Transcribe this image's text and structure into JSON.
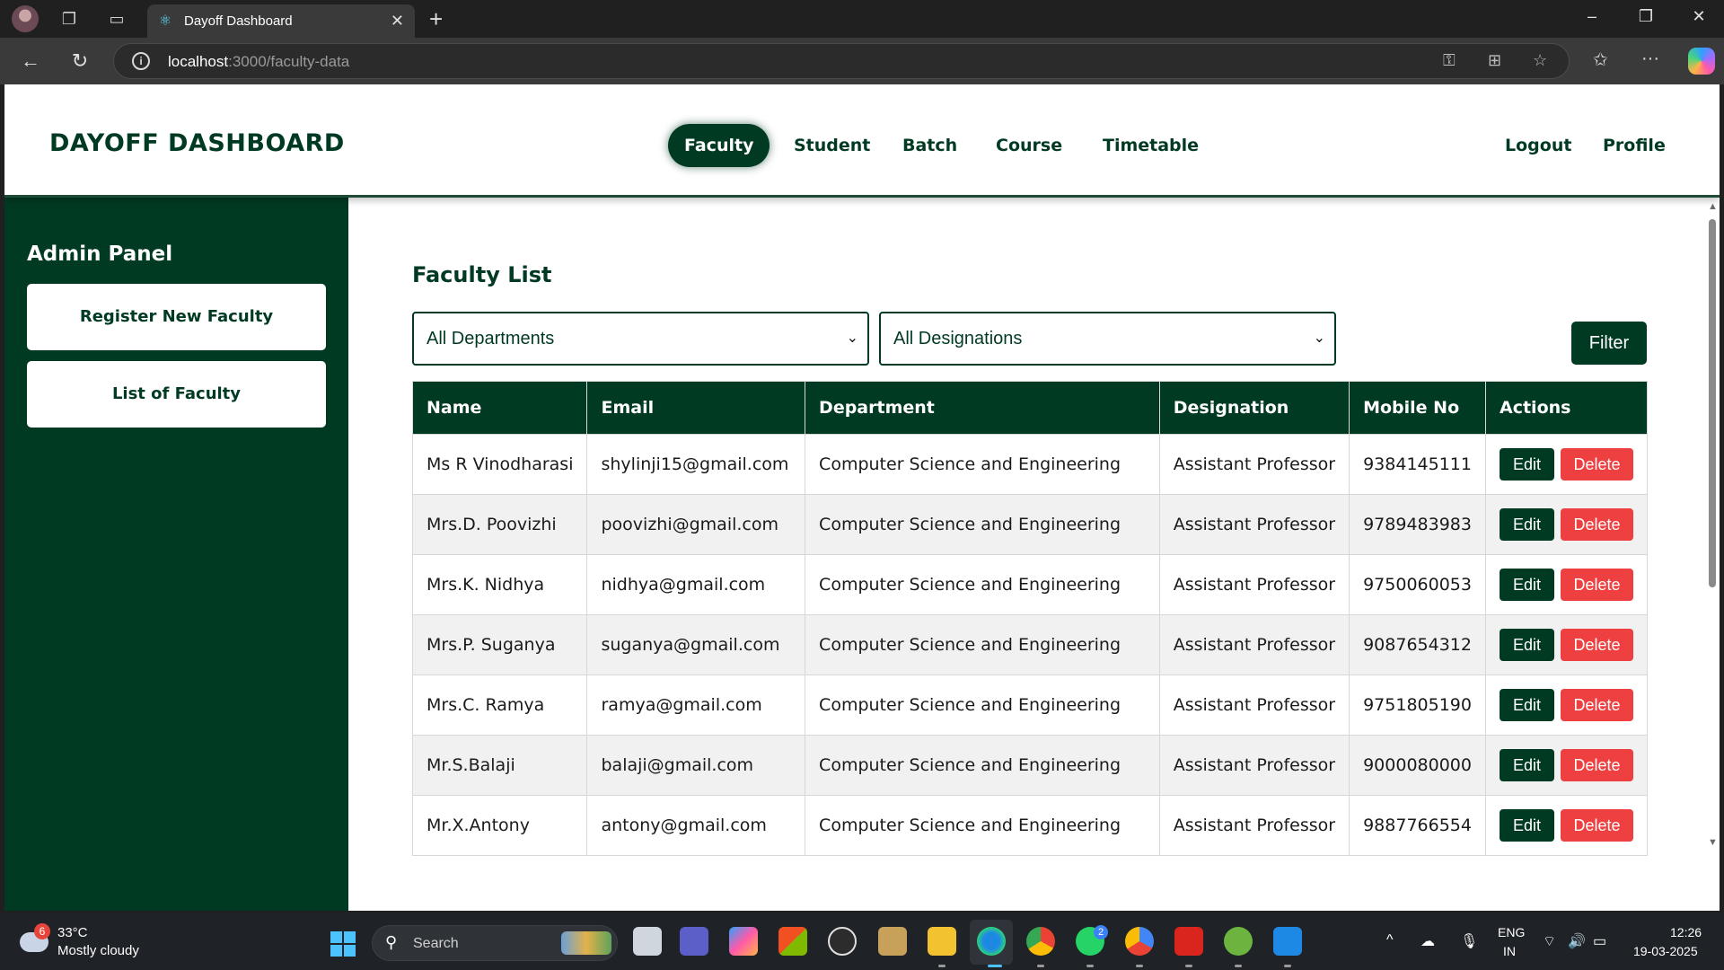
{
  "browser": {
    "tab_title": "Dayoff Dashboard",
    "url_host": "localhost",
    "url_path": ":3000/faculty-data"
  },
  "header": {
    "brand": "DAYOFF DASHBOARD",
    "nav": [
      "Faculty",
      "Student",
      "Batch",
      "Course",
      "Timetable"
    ],
    "active_nav": "Faculty",
    "logout": "Logout",
    "profile": "Profile"
  },
  "sidebar": {
    "title": "Admin Panel",
    "buttons": [
      "Register New Faculty",
      "List of Faculty"
    ]
  },
  "main": {
    "title": "Faculty List",
    "department_select": "All Departments",
    "designation_select": "All Designations",
    "filter_label": "Filter",
    "columns": [
      "Name",
      "Email",
      "Department",
      "Designation",
      "Mobile No",
      "Actions"
    ],
    "edit_label": "Edit",
    "delete_label": "Delete",
    "rows": [
      {
        "name": "Ms R Vinodharasi",
        "email": "shylinji15@gmail.com",
        "department": "Computer Science and Engineering",
        "designation": "Assistant Professor",
        "mobile": "9384145111"
      },
      {
        "name": "Mrs.D. Poovizhi",
        "email": "poovizhi@gmail.com",
        "department": "Computer Science and Engineering",
        "designation": "Assistant Professor",
        "mobile": "9789483983"
      },
      {
        "name": "Mrs.K. Nidhya",
        "email": "nidhya@gmail.com",
        "department": "Computer Science and Engineering",
        "designation": "Assistant Professor",
        "mobile": "9750060053"
      },
      {
        "name": "Mrs.P. Suganya",
        "email": "suganya@gmail.com",
        "department": "Computer Science and Engineering",
        "designation": "Assistant Professor",
        "mobile": "9087654312"
      },
      {
        "name": "Mrs.C. Ramya",
        "email": "ramya@gmail.com",
        "department": "Computer Science and Engineering",
        "designation": "Assistant Professor",
        "mobile": "9751805190"
      },
      {
        "name": "Mr.S.Balaji",
        "email": "balaji@gmail.com",
        "department": "Computer Science and Engineering",
        "designation": "Assistant Professor",
        "mobile": "9000080000"
      },
      {
        "name": "Mr.X.Antony",
        "email": "antony@gmail.com",
        "department": "Computer Science and Engineering",
        "designation": "Assistant Professor",
        "mobile": "9887766554"
      }
    ]
  },
  "taskbar": {
    "weather_badge": "6",
    "weather_temp": "33°C",
    "weather_desc": "Mostly cloudy",
    "search_label": "Search",
    "whatsapp_badge": "2",
    "lang_line1": "ENG",
    "lang_line2": "IN",
    "time": "12:26",
    "date": "19-03-2025"
  },
  "colors": {
    "primary": "#013a23",
    "delete": "#ee4040",
    "row_alt": "#f1f1f1"
  }
}
